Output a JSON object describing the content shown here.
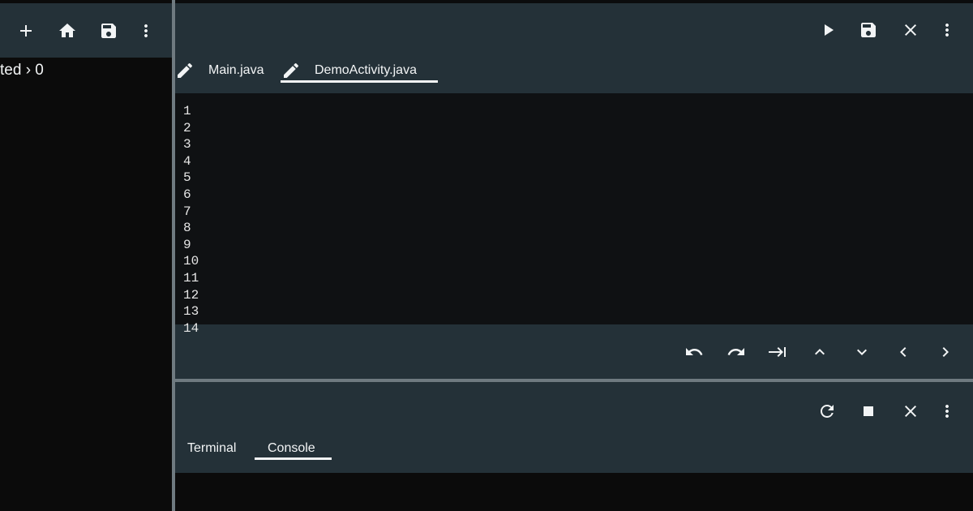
{
  "left_panel": {
    "toolbar": {
      "icons": [
        "plus-icon",
        "home-icon",
        "save-icon",
        "more-vert-icon"
      ]
    },
    "breadcrumb": "ted › 0"
  },
  "editor": {
    "toolbar": {
      "icons": [
        "play-icon",
        "save-icon",
        "close-icon",
        "more-vert-icon"
      ]
    },
    "tabs": [
      {
        "label": "Main.java",
        "icon": "edit-pencil-icon",
        "active": false
      },
      {
        "label": "DemoActivity.java",
        "icon": "edit-pencil-icon",
        "active": true
      }
    ],
    "line_numbers": [
      "1",
      "2",
      "3",
      "4",
      "5",
      "6",
      "7",
      "8",
      "9",
      "10",
      "11",
      "12",
      "13",
      "14"
    ],
    "bottom_toolbar": {
      "icons": [
        "undo-icon",
        "redo-icon",
        "tab-indent-icon",
        "chevron-up-icon",
        "chevron-down-icon",
        "chevron-left-icon",
        "chevron-right-icon"
      ]
    }
  },
  "console": {
    "toolbar": {
      "icons": [
        "refresh-icon",
        "stop-icon",
        "close-icon",
        "more-vert-icon"
      ]
    },
    "tabs": [
      {
        "label": "Terminal",
        "active": false
      },
      {
        "label": "Console",
        "active": true
      }
    ]
  },
  "colors": {
    "panel": "#243138",
    "background": "#0b0b0b",
    "divider": "#6f7a80",
    "text": "#f2f4f5"
  }
}
